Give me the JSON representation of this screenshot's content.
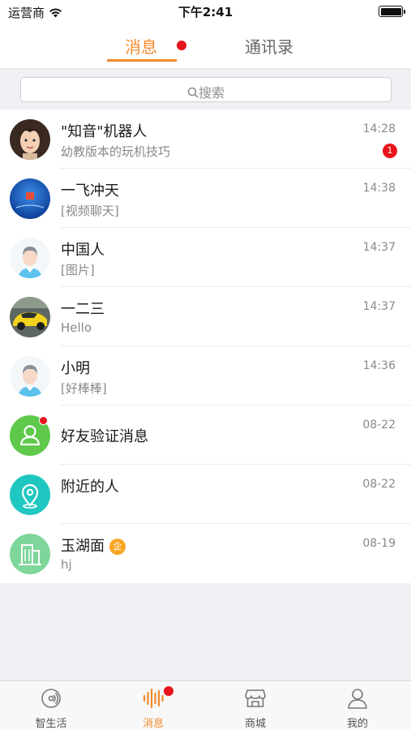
{
  "status_bar": {
    "carrier": "运营商",
    "time": "下午2:41"
  },
  "top_tabs": {
    "messages": "消息",
    "contacts": "通讯录"
  },
  "search": {
    "label": "搜索"
  },
  "conversations": [
    {
      "name": "\"知音\"机器人",
      "preview": "幼教版本的玩机技巧",
      "time": "14:28",
      "unread": "1",
      "avatar_icon": "woman-avatar-icon"
    },
    {
      "name": "一飞冲天",
      "preview": "[视频聊天]",
      "time": "14:38",
      "avatar_icon": "blue-globe-avatar-icon"
    },
    {
      "name": "中国人",
      "preview": "[图片]",
      "time": "14:37",
      "avatar_icon": "default-person-avatar-icon"
    },
    {
      "name": "一二三",
      "preview": "Hello",
      "time": "14:37",
      "avatar_icon": "yellow-car-avatar-icon"
    },
    {
      "name": "小明",
      "preview": "[好棒棒]",
      "time": "14:36",
      "avatar_icon": "default-person-avatar-icon"
    },
    {
      "name": "好友验证消息",
      "preview": "",
      "time": "08-22",
      "avatar_icon": "friend-verify-icon"
    },
    {
      "name": "附近的人",
      "preview": "",
      "time": "08-22",
      "avatar_icon": "nearby-location-icon"
    },
    {
      "name": "玉湖面",
      "badge": "企",
      "preview": "hj",
      "time": "08-19",
      "avatar_icon": "building-icon"
    }
  ],
  "tab_bar": [
    {
      "label": "智生活",
      "icon": "smart-life-icon"
    },
    {
      "label": "消息",
      "icon": "sound-wave-icon",
      "active": true
    },
    {
      "label": "商城",
      "icon": "shop-icon"
    },
    {
      "label": "我的",
      "icon": "person-icon"
    }
  ],
  "colors": {
    "accent": "#f08a2c",
    "badge": "#e8141b",
    "green": "#5ec94b",
    "teal": "#1fc7c0"
  }
}
